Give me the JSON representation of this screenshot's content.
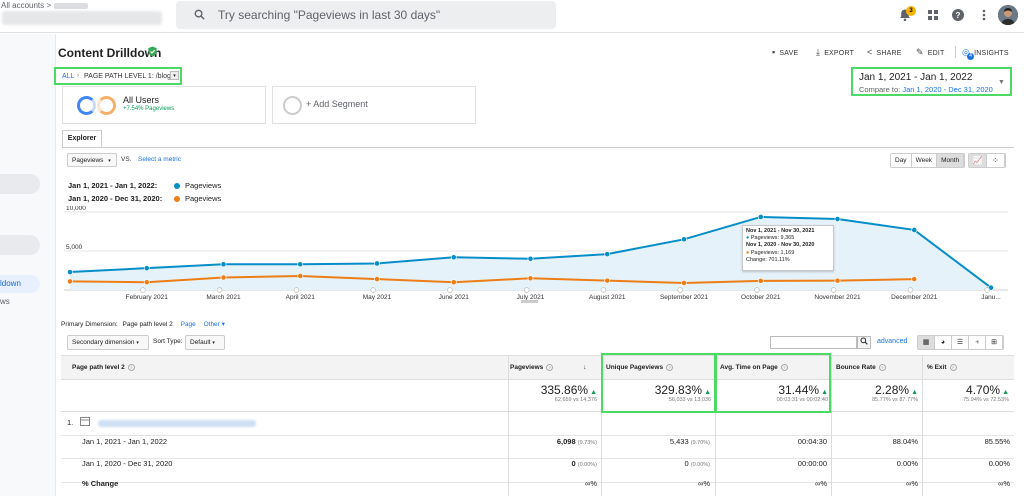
{
  "topbar": {
    "breadcrumb": "All accounts >",
    "search_placeholder": "Try searching \"Pageviews in last 30 days\"",
    "notification_count": "3"
  },
  "sidebar": {
    "active_item_fragment": "ldown",
    "item_fragment_below": "ws"
  },
  "report": {
    "title": "Content Drilldown",
    "actions": [
      "SAVE",
      "EXPORT",
      "SHARE",
      "EDIT",
      "INSIGHTS"
    ],
    "insights_badge": "4"
  },
  "path": {
    "all": "ALL",
    "level": "PAGE PATH LEVEL 1: /blog/"
  },
  "date_range": {
    "current": "Jan 1, 2021 - Jan 1, 2022",
    "compare_label": "Compare to:",
    "compare": "Jan 1, 2020 - Dec 31, 2020"
  },
  "segments": {
    "active": "All Users",
    "active_sub": "+7.54% Pageviews",
    "add": "+ Add Segment"
  },
  "explorer": {
    "tab": "Explorer",
    "metric": "Pageviews",
    "vs": "VS.",
    "select_metric": "Select a metric",
    "periods": [
      "Day",
      "Week",
      "Month"
    ],
    "active_period": "Month"
  },
  "legend": [
    {
      "range": "Jan 1, 2021 - Jan 1, 2022:",
      "metric": "Pageviews",
      "color": "#058dc7"
    },
    {
      "range": "Jan 1, 2020 - Dec 31, 2020:",
      "metric": "Pageviews",
      "color": "#ed7e17"
    }
  ],
  "chart_data": {
    "type": "area",
    "y_ticks": [
      "10,000",
      "5,000"
    ],
    "ylim": [
      0,
      10000
    ],
    "x_labels": [
      "February 2021",
      "March 2021",
      "April 2021",
      "May 2021",
      "June 2021",
      "July 2021",
      "August 2021",
      "September 2021",
      "October 2021",
      "November 2021",
      "December 2021",
      "Janu..."
    ],
    "series": [
      {
        "name": "Jan 1, 2021 - Jan 1, 2022",
        "color": "#058dc7",
        "values": [
          2300,
          2800,
          3300,
          3300,
          3400,
          4200,
          4000,
          4600,
          6500,
          9365,
          9100,
          7700,
          300
        ]
      },
      {
        "name": "Jan 1, 2020 - Dec 31, 2020",
        "color": "#ed7e17",
        "values": [
          1100,
          1000,
          1600,
          1800,
          1400,
          1000,
          1500,
          1200,
          900,
          1169,
          1200,
          1400
        ]
      }
    ],
    "tooltip": {
      "range1": "Nov 1, 2021 - Nov 30, 2021",
      "value1": "Pageviews: 9,365",
      "range2": "Nov 1, 2020 - Nov 30, 2020",
      "value2": "Pageviews: 1,169",
      "change": "Change: 701.11%"
    }
  },
  "table_controls": {
    "primary_label": "Primary Dimension:",
    "primary_active": "Page path level 2",
    "primary_other": [
      "Page",
      "Other"
    ],
    "secondary": "Secondary dimension",
    "sort_label": "Sort Type:",
    "sort_value": "Default",
    "advanced": "advanced"
  },
  "table": {
    "dimension_header": "Page path level 2",
    "headers": [
      "Pageviews",
      "Unique Pageviews",
      "Avg. Time on Page",
      "Bounce Rate",
      "% Exit"
    ],
    "totals": [
      {
        "big": "335.86%",
        "small": "62,659 vs 14,376"
      },
      {
        "big": "329.83%",
        "small": "56,033 vs 13,036"
      },
      {
        "big": "31.44%",
        "small": "00:03:31 vs 00:02:40"
      },
      {
        "big": "2.28%",
        "small": "85.77% vs 87.77%"
      },
      {
        "big": "4.70%",
        "small": "75.94% vs 72.53%"
      }
    ],
    "row_index": "1.",
    "rows": [
      {
        "label": "Jan 1, 2021 - Jan 1, 2022",
        "pv": "6,098",
        "pv_pct": "(9.73%)",
        "upv": "5,433",
        "upv_pct": "(9.70%)",
        "time": "00:04:30",
        "bounce": "88.04%",
        "exit": "85.55%"
      },
      {
        "label": "Jan 1, 2020 - Dec 31, 2020",
        "pv": "0",
        "pv_pct": "(0.00%)",
        "upv": "0",
        "upv_pct": "(0.00%)",
        "time": "00:00:00",
        "bounce": "0.00%",
        "exit": "0.00%"
      },
      {
        "label": "% Change",
        "pv": "∞%",
        "pv_pct": "",
        "upv": "∞%",
        "upv_pct": "",
        "time": "∞%",
        "bounce": "∞%",
        "exit": "∞%"
      }
    ]
  }
}
